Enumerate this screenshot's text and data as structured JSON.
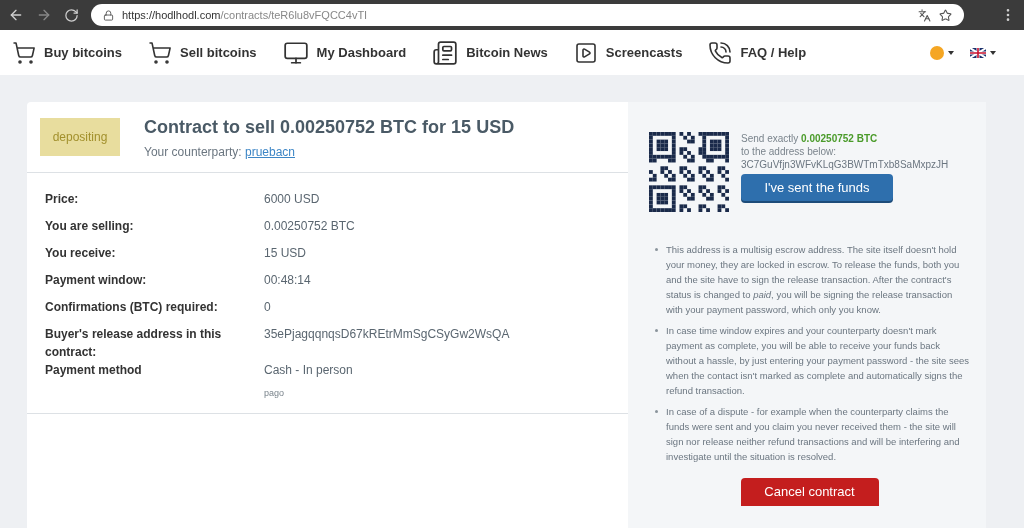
{
  "browser": {
    "url_host": "https://hodlhodl.com",
    "url_path": "/contracts/teR6lu8vFQCC4vTI"
  },
  "nav": [
    {
      "label": "Buy bitcoins",
      "kind": "buy"
    },
    {
      "label": "Sell bitcoins",
      "kind": "sell"
    },
    {
      "label": "My Dashboard",
      "kind": "dashboard"
    },
    {
      "label": "Bitcoin News",
      "kind": "news"
    },
    {
      "label": "Screencasts",
      "kind": "screencasts"
    },
    {
      "label": "FAQ / Help",
      "kind": "faq"
    }
  ],
  "contract": {
    "status": "depositing",
    "title": "Contract to sell 0.00250752 BTC for 15 USD",
    "counterparty_label": "Your counterparty:",
    "counterparty": "pruebacn"
  },
  "details": [
    {
      "label": "Price:",
      "value": "6000 USD"
    },
    {
      "label": "You are selling:",
      "value": "0.00250752 BTC"
    },
    {
      "label": "You receive:",
      "value": "15 USD"
    },
    {
      "label": "Payment window:",
      "value": "00:48:14"
    },
    {
      "label": "Confirmations (BTC) required:",
      "value": "0"
    },
    {
      "label": "Buyer's release address in this contract:",
      "value": "35ePjagqqnqsD67kREtrMmSgCSyGw2WsQA"
    },
    {
      "label": "Payment method",
      "value": "Cash - In person",
      "note": "pago"
    }
  ],
  "deposit": {
    "send_prefix": "Send exactly",
    "amount": "0.00250752 BTC",
    "address_label": "to the address below:",
    "address": "3C7GuVfjn3WFvKLqG3BWTmTxb8SaMxpzJH",
    "button": "I've sent the funds"
  },
  "notes": [
    "This address is a multisig escrow address. The site itself doesn't hold your money, they are locked in escrow. To release the funds, both you and the site have to sign the release transaction. After the contract's status is changed to *paid*, you will be signing the release transaction with your payment password, which only you know.",
    "In case time window expires and your counterparty doesn't mark payment as complete, you will be able to receive your funds back without a hassle, by just entering your payment password - the site sees when the contact isn't marked as complete and automatically signs the refund transaction.",
    "In case of a dispute - for example when the counterparty claims the funds were sent and you claim you never received them - the site will sign nor release neither refund transactions and will be interfering and investigate until the situation is resolved."
  ],
  "cancel_button": "Cancel contract"
}
